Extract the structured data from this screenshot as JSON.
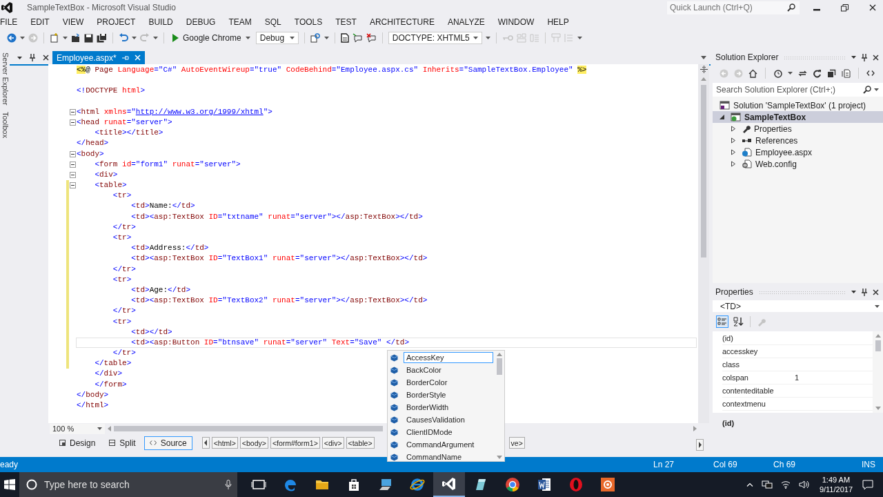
{
  "window": {
    "title": "SampleTextBox - Microsoft Visual Studio",
    "quick_launch": {
      "placeholder": "Quick Launch (Ctrl+Q)"
    }
  },
  "menu": [
    "FILE",
    "EDIT",
    "VIEW",
    "PROJECT",
    "BUILD",
    "DEBUG",
    "TEAM",
    "SQL",
    "TOOLS",
    "TEST",
    "ARCHITECTURE",
    "ANALYZE",
    "WINDOW",
    "HELP"
  ],
  "toolbar": {
    "browser": "Google Chrome",
    "configuration": "Debug",
    "doctype": "DOCTYPE: XHTML5"
  },
  "side_tabs": [
    "Server Explorer",
    "Toolbox"
  ],
  "editor_tab": {
    "label": "Employee.aspx*",
    "selected": true
  },
  "code": [
    {
      "text": "<%@ Page Language=\"C#\" AutoEventWireup=\"true\" CodeBehind=\"Employee.aspx.cs\" Inherits=\"SampleTextBox.Employee\" %>",
      "foldable": false,
      "changed": false,
      "current": false
    },
    {
      "text": "<!DOCTYPE html>",
      "foldable": false,
      "changed": false,
      "current": false,
      "blank_before": true
    },
    {
      "text": "<html xmlns=\"http://www.w3.org/1999/xhtml\">",
      "foldable": true,
      "changed": false,
      "current": false,
      "blank_before": true
    },
    {
      "text": "<head runat=\"server\">",
      "foldable": true,
      "changed": false,
      "current": false
    },
    {
      "text": "    <title></title>",
      "foldable": false,
      "changed": false,
      "current": false
    },
    {
      "text": "</head>",
      "foldable": false,
      "changed": false,
      "current": false
    },
    {
      "text": "<body>",
      "foldable": true,
      "changed": false,
      "current": false
    },
    {
      "text": "    <form id=\"form1\" runat=\"server\">",
      "foldable": true,
      "changed": false,
      "current": false
    },
    {
      "text": "    <div>",
      "foldable": true,
      "changed": false,
      "current": false
    },
    {
      "text": "    <table>",
      "foldable": true,
      "changed": true,
      "current": false
    },
    {
      "text": "        <tr>",
      "foldable": false,
      "changed": true,
      "current": false
    },
    {
      "text": "            <td>Name:</td>",
      "foldable": false,
      "changed": true,
      "current": false
    },
    {
      "text": "            <td><asp:TextBox ID=\"txtname\" runat=\"server\"></asp:TextBox></td>",
      "foldable": false,
      "changed": true,
      "current": false
    },
    {
      "text": "        </tr>",
      "foldable": false,
      "changed": true,
      "current": false
    },
    {
      "text": "        <tr>",
      "foldable": false,
      "changed": true,
      "current": false
    },
    {
      "text": "            <td>Address:</td>",
      "foldable": false,
      "changed": true,
      "current": false
    },
    {
      "text": "            <td><asp:TextBox ID=\"TextBox1\" runat=\"server\"></asp:TextBox></td>",
      "foldable": false,
      "changed": true,
      "current": false
    },
    {
      "text": "        </tr>",
      "foldable": false,
      "changed": true,
      "current": false
    },
    {
      "text": "        <tr>",
      "foldable": false,
      "changed": true,
      "current": false
    },
    {
      "text": "            <td>Age:</td>",
      "foldable": false,
      "changed": true,
      "current": false
    },
    {
      "text": "            <td><asp:TextBox ID=\"TextBox2\" runat=\"server\"></asp:TextBox></td>",
      "foldable": false,
      "changed": true,
      "current": false
    },
    {
      "text": "        </tr>",
      "foldable": false,
      "changed": true,
      "current": false
    },
    {
      "text": "        <tr>",
      "foldable": false,
      "changed": true,
      "current": false
    },
    {
      "text": "            <td></td>",
      "foldable": false,
      "changed": true,
      "current": false
    },
    {
      "text": "            <td><asp:Button ID=\"btnsave\" runat=\"server\" Text=\"Save\" </td>",
      "foldable": false,
      "changed": true,
      "current": true
    },
    {
      "text": "        </tr>",
      "foldable": false,
      "changed": true,
      "current": false
    },
    {
      "text": "    </table>",
      "foldable": false,
      "changed": true,
      "current": false
    },
    {
      "text": "    </div>",
      "foldable": false,
      "changed": false,
      "current": false
    },
    {
      "text": "    </form>",
      "foldable": false,
      "changed": false,
      "current": false
    },
    {
      "text": "</body>",
      "foldable": false,
      "changed": false,
      "current": false
    },
    {
      "text": "</html>",
      "foldable": false,
      "changed": false,
      "current": false
    }
  ],
  "zoom": "100 %",
  "views": [
    {
      "label": "Design",
      "selected": false
    },
    {
      "label": "Split",
      "selected": false
    },
    {
      "label": "Source",
      "selected": true
    }
  ],
  "breadcrumbs": [
    "<html>",
    "<body>",
    "<form#form1>",
    "<div>",
    "<table>"
  ],
  "breadcrumb_tail": "ve>",
  "autocomplete": [
    {
      "label": "AccessKey",
      "selected": true
    },
    {
      "label": "BackColor",
      "selected": false
    },
    {
      "label": "BorderColor",
      "selected": false
    },
    {
      "label": "BorderStyle",
      "selected": false
    },
    {
      "label": "BorderWidth",
      "selected": false
    },
    {
      "label": "CausesValidation",
      "selected": false
    },
    {
      "label": "ClientIDMode",
      "selected": false
    },
    {
      "label": "CommandArgument",
      "selected": false
    },
    {
      "label": "CommandName",
      "selected": false
    }
  ],
  "solution_explorer": {
    "title": "Solution Explorer",
    "search": {
      "placeholder": "Search Solution Explorer (Ctrl+;)"
    },
    "tree": [
      {
        "label": "Solution 'SampleTextBox' (1 project)",
        "kind": "solution",
        "selected": false,
        "children": [
          {
            "label": "SampleTextBox",
            "kind": "project",
            "selected": true,
            "expanded": true,
            "children": [
              {
                "label": "Properties",
                "kind": "properties",
                "selected": false,
                "expanded": false
              },
              {
                "label": "References",
                "kind": "references",
                "selected": false,
                "expanded": false
              },
              {
                "label": "Employee.aspx",
                "kind": "page",
                "selected": false,
                "expanded": false
              },
              {
                "label": "Web.config",
                "kind": "config",
                "selected": false,
                "expanded": false
              }
            ]
          }
        ]
      }
    ]
  },
  "properties": {
    "title": "Properties",
    "object": "<TD>",
    "rows": [
      {
        "name": "(id)"
      },
      {
        "name": "accesskey"
      },
      {
        "name": "class"
      },
      {
        "name": "colspan",
        "value": "1"
      },
      {
        "name": "contenteditable"
      },
      {
        "name": "contextmenu"
      }
    ],
    "description": "(id)"
  },
  "status": {
    "message": "eady",
    "line": "Ln 27",
    "column": "Col 69",
    "char": "Ch 69",
    "mode": "INS"
  },
  "taskbar": {
    "search": {
      "placeholder": "Type here to search"
    },
    "apps": [
      {
        "kind": "task-view",
        "selected": false
      },
      {
        "kind": "edge",
        "selected": false
      },
      {
        "kind": "folder",
        "selected": false
      },
      {
        "kind": "store",
        "selected": false
      },
      {
        "kind": "computer",
        "selected": false
      },
      {
        "kind": "ie",
        "selected": false
      },
      {
        "kind": "vs",
        "selected": true
      },
      {
        "kind": "tablet",
        "selected": false
      },
      {
        "kind": "chrome",
        "selected": false
      },
      {
        "kind": "word",
        "selected": false
      },
      {
        "kind": "opera",
        "selected": false
      },
      {
        "kind": "recorder",
        "selected": false
      }
    ],
    "time": "1:49 AM",
    "date": "9/11/2017"
  }
}
